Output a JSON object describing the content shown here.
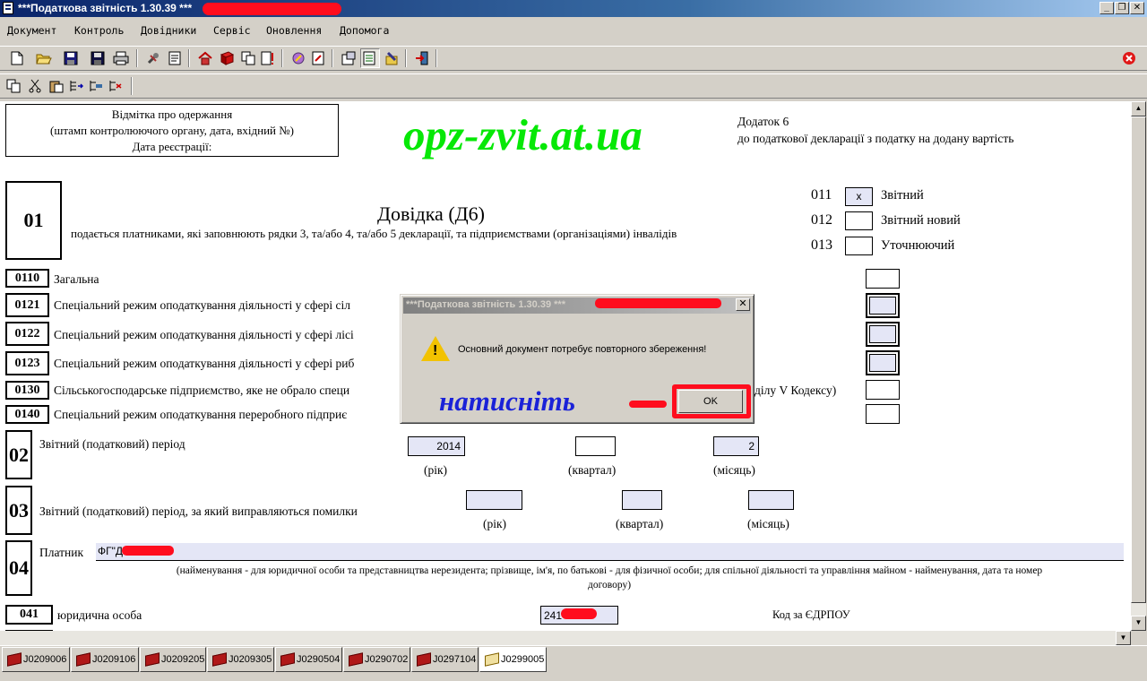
{
  "window": {
    "title": "***Податкова звітність 1.30.39 ***"
  },
  "menu": [
    "Документ",
    "Контроль",
    "Довідники",
    "Сервіс",
    "Оновлення",
    "Допомога"
  ],
  "watermark": "opz-zvit.at.ua",
  "stamp": {
    "line1": "Відмітка про одержання",
    "line2": "(штамп контролюючого органу, дата, вхідний №)",
    "line3": "Дата реєстрації:"
  },
  "appendix": {
    "line1": "Додаток 6",
    "line2": "до податкової декларації з податку на додану вартість"
  },
  "section01": {
    "number": "01",
    "title": "Довідка (Д6)",
    "subtitle": "подається платниками, які заповнюють рядки 3, та/або 4, та/або 5 декларації, та підприємствами (організаціями) інвалідів"
  },
  "report_type": [
    {
      "code": "011",
      "label": "Звітний",
      "mark": "x"
    },
    {
      "code": "012",
      "label": "Звітний новий",
      "mark": ""
    },
    {
      "code": "013",
      "label": "Уточнюючий",
      "mark": ""
    }
  ],
  "rows": [
    {
      "code": "0110",
      "label": "Загальна"
    },
    {
      "code": "0121",
      "label": "Спеціальний режим оподаткування діяльності у сфері сіл"
    },
    {
      "code": "0122",
      "label": "Спеціальний режим оподаткування діяльності у сфері лісі"
    },
    {
      "code": "0123",
      "label": "Спеціальний режим оподаткування діяльності у сфері риб"
    },
    {
      "code": "0130",
      "label": "Сільськогосподарське підприємство, яке не обрало специ"
    },
    {
      "code": "0140",
      "label": "Спеціальний режим оподаткування переробного підприє"
    }
  ],
  "row0130_tail": "ділу V Кодексу)",
  "section02": {
    "number": "02",
    "label": "Звітний (податковий) період",
    "year": "2014",
    "quarter": "",
    "month": "2",
    "year_caption": "(рік)",
    "quarter_caption": "(квартал)",
    "month_caption": "(місяць)"
  },
  "section03": {
    "number": "03",
    "label": "Звітний (податковий) період, за який виправляються помилки",
    "year_caption": "(рік)",
    "quarter_caption": "(квартал)",
    "month_caption": "(місяць)"
  },
  "section04": {
    "number": "04",
    "label": "Платник",
    "value": "ФГ\"Д",
    "note_line1": "(найменування - для юридичної особи та представництва нерезидента; прізвище, ім'я, по батькові - для фізичної особи; для спільної діяльності та управління майном - найменування, дата та номер",
    "note_line2": "договору)"
  },
  "section041": {
    "code": "041",
    "label": "юридична особа",
    "value": "241",
    "edrpou_label": "Код за ЄДРПОУ"
  },
  "dialog": {
    "title": "***Податкова звітність 1.30.39 ***",
    "message": "Основний документ потребує повторного збереження!",
    "ok": "OK",
    "close": "✕"
  },
  "annotation": "натисніть",
  "tabs": [
    {
      "label": "J0209006",
      "active": false
    },
    {
      "label": "J0209106",
      "active": false
    },
    {
      "label": "J0209205",
      "active": false
    },
    {
      "label": "J0209305",
      "active": false
    },
    {
      "label": "J0290504",
      "active": false
    },
    {
      "label": "J0290702",
      "active": false
    },
    {
      "label": "J0297104",
      "active": false
    },
    {
      "label": "J0299005",
      "active": true
    }
  ],
  "colors": {
    "input_fill": "#e4e6f6",
    "watermark": "#06e806",
    "annotation": "#1a22d8",
    "highlight_red": "#ff0d1e"
  }
}
